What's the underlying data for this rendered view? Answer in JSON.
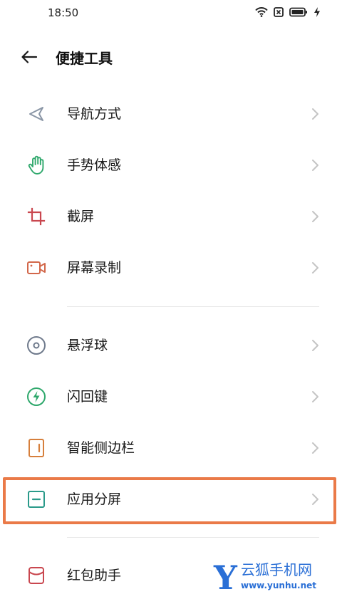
{
  "status_bar": {
    "time": "18:50",
    "icons": [
      "wifi-icon",
      "sim-card-icon",
      "battery-icon",
      "charging-icon"
    ]
  },
  "header": {
    "title": "便捷工具",
    "back_icon": "back-arrow-icon"
  },
  "groups": [
    {
      "items": [
        {
          "id": "navigation",
          "label": "导航方式",
          "icon": "navigation-triangle-icon",
          "color": "#8a96a6"
        },
        {
          "id": "gestures",
          "label": "手势体感",
          "icon": "hand-icon",
          "color": "#2fa86c"
        },
        {
          "id": "screenshot",
          "label": "截屏",
          "icon": "crop-icon",
          "color": "#c9474f"
        },
        {
          "id": "screen-record",
          "label": "屏幕录制",
          "icon": "video-camera-icon",
          "color": "#d2674a"
        }
      ]
    },
    {
      "items": [
        {
          "id": "floating-ball",
          "label": "悬浮球",
          "icon": "floating-ball-icon",
          "color": "#6f7a8c"
        },
        {
          "id": "flashback",
          "label": "闪回键",
          "icon": "lightning-circle-icon",
          "color": "#2fa86c"
        },
        {
          "id": "smart-sidebar",
          "label": "智能侧边栏",
          "icon": "sidebar-icon",
          "color": "#d67f3c"
        },
        {
          "id": "split-screen",
          "label": "应用分屏",
          "icon": "split-screen-icon",
          "color": "#2a9a8a"
        }
      ]
    },
    {
      "items": [
        {
          "id": "red-envelope",
          "label": "红包助手",
          "icon": "envelope-icon",
          "color": "#c9474f"
        }
      ]
    }
  ],
  "highlight_color": "#ea7a48",
  "watermark": {
    "letter": "Y",
    "brand": "云狐手机网",
    "url": "www.yunhu.net",
    "color": "#2a6fd6"
  }
}
